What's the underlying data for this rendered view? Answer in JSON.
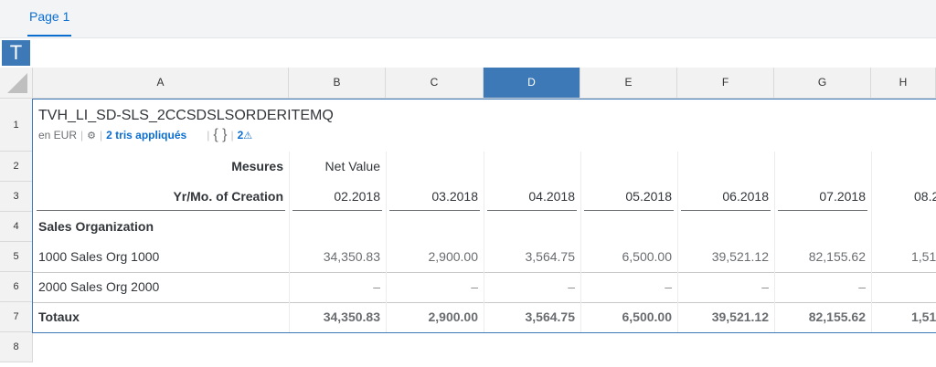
{
  "tabs": [
    {
      "label": "Page 1"
    }
  ],
  "toolbar": {
    "text_tool_label": "T"
  },
  "columns": [
    "A",
    "B",
    "C",
    "D",
    "E",
    "F",
    "G",
    "H"
  ],
  "selected_column": "D",
  "rows": [
    "1",
    "2",
    "3",
    "4",
    "5",
    "6",
    "7",
    "8"
  ],
  "table": {
    "title": "TVH_LI_SD-SLS_2CCSDSLSORDERITEMQ",
    "currency": "en EUR",
    "sorts": "2 tris appliqués",
    "braces": "{ }",
    "warnings": "2"
  },
  "measures_label": "Mesures",
  "measure_name": "Net Value",
  "period_label": "Yr/Mo. of Creation",
  "periods": [
    "02.2018",
    "03.2018",
    "04.2018",
    "05.2018",
    "06.2018",
    "07.2018",
    "08.2"
  ],
  "dimension_label": "Sales Organization",
  "data_rows": [
    {
      "label": "1000 Sales Org 1000",
      "values": [
        "34,350.83",
        "2,900.00",
        "3,564.75",
        "6,500.00",
        "39,521.12",
        "82,155.62",
        "1,51"
      ]
    },
    {
      "label": "2000 Sales Org 2000",
      "values": [
        "–",
        "–",
        "–",
        "–",
        "–",
        "–",
        ""
      ]
    }
  ],
  "totals": {
    "label": "Totaux",
    "values": [
      "34,350.83",
      "2,900.00",
      "3,564.75",
      "6,500.00",
      "39,521.12",
      "82,155.62",
      "1,51"
    ]
  }
}
